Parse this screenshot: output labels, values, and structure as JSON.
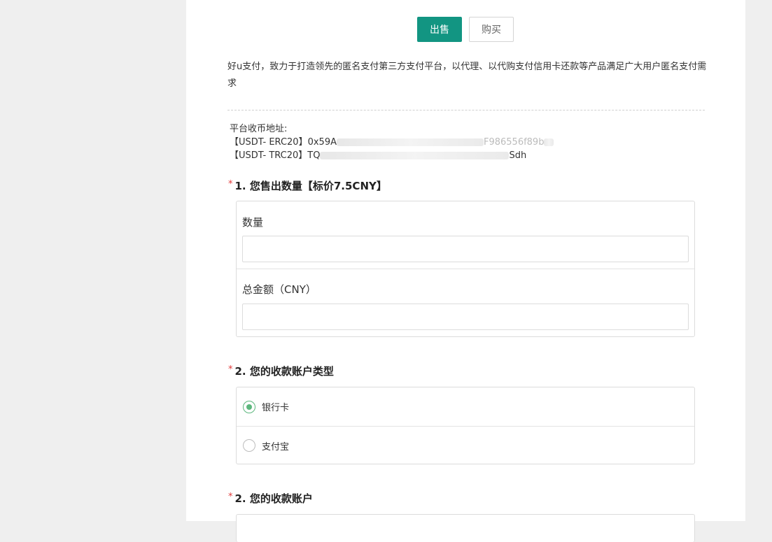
{
  "tabs": {
    "sell_label": "出售",
    "buy_label": "购买"
  },
  "intro_text": "好u支付，致力于打造领先的匿名支付第三方支付平台，以代理、以代购支付信用卡还款等产品满足广大用户匿名支付需求",
  "address": {
    "title": "平台收币地址:",
    "erc20_label": "【USDT- ERC20】",
    "erc20_start": "0x59A",
    "erc20_end": "F986556f89b",
    "trc20_label": "【USDT- TRC20】",
    "trc20_start": "TQ",
    "trc20_end": "Sdh"
  },
  "q1": {
    "required": "*",
    "title": "1. 您售出数量【标价7.5CNY】",
    "quantity_label": "数量",
    "quantity_value": "",
    "total_label": "总金额（CNY）",
    "total_value": ""
  },
  "q2": {
    "required": "*",
    "title": "2. 您的收款账户类型",
    "options": [
      "银行卡",
      "支付宝"
    ],
    "selected": "银行卡"
  },
  "q3": {
    "required": "*",
    "title": "2. 您的收款账户"
  },
  "colors": {
    "accent": "#129582",
    "radio": "#5cb77d",
    "required": "#e23b3b"
  }
}
